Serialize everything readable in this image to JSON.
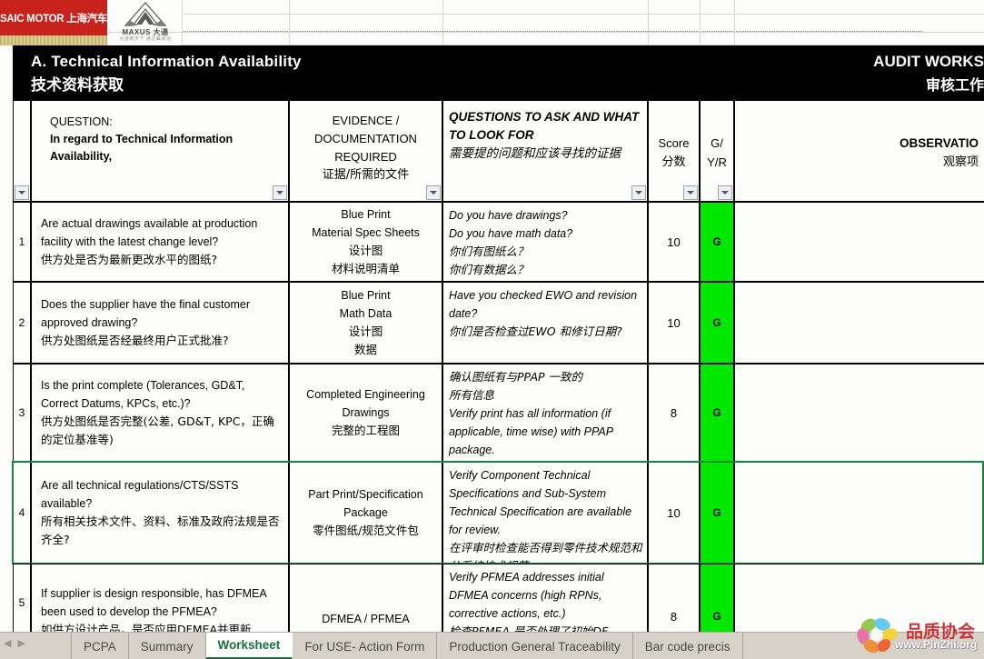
{
  "branding": {
    "saic_logo_text": "SAIC MOTOR 上海汽车",
    "maxus_wordmark": "MAXUS 大通",
    "maxus_tagline": "大道致天下  通达赢成功"
  },
  "banner": {
    "section_en": "A.  Technical Information Availability",
    "section_cn": "技术资料获取",
    "doc_title_en": "AUDIT WORKS",
    "doc_title_cn": "审核工作"
  },
  "columns": {
    "row_number": "",
    "question": {
      "label": "QUESTION:",
      "label_bold": "In regard to Technical Information Availability,"
    },
    "evidence": {
      "en": "EVIDENCE / DOCUMENTATION REQUIRED",
      "cn": "证据/所需的文件"
    },
    "questions_to_ask": {
      "en": "QUESTIONS TO ASK AND WHAT TO LOOK FOR",
      "cn": "需要提的问题和应该寻找的证据"
    },
    "score": {
      "en": "Score",
      "cn": "分数"
    },
    "gyr": {
      "en": "G/",
      "en2": "Y/R"
    },
    "observations": {
      "en": "OBSERVATIO",
      "cn": "观察项"
    }
  },
  "filter_buttons": [
    "filter-question",
    "filter-evidence",
    "filter-questions-to-ask",
    "filter-score",
    "filter-gyr"
  ],
  "rows": [
    {
      "num": "1",
      "question_en": "Are actual drawings available at production facility with the latest change level?",
      "question_cn": "供方处是否为最新更改水平的图纸?",
      "evidence_en": [
        "Blue Print",
        "Material Spec Sheets"
      ],
      "evidence_cn": [
        "设计图",
        "材料说明清单"
      ],
      "ask_en": [
        "Do you have drawings?",
        "Do you have math data?"
      ],
      "ask_cn": [
        "你们有图纸么？",
        "你们有数据么？"
      ],
      "score": "10",
      "gyr": "G",
      "gyr_color": "#00E800",
      "observations": ""
    },
    {
      "num": "2",
      "question_en": "Does the supplier have the final customer approved drawing?",
      "question_cn": "供方处图纸是否经最终用户正式批准?",
      "evidence_en": [
        "Blue Print",
        "Math Data"
      ],
      "evidence_cn": [
        "设计图",
        "数据"
      ],
      "ask_en": [
        "Have you checked EWO and revision date?"
      ],
      "ask_cn": [
        "你们是否检查过EWO 和修订日期?"
      ],
      "score": "10",
      "gyr": "G",
      "gyr_color": "#00E800",
      "observations": ""
    },
    {
      "num": "3",
      "question_en": "Is the print complete (Tolerances, GD&T, Correct Datums, KPCs, etc.)?",
      "question_cn": "供方处图纸是否完整(公差, GD&T, KPC，正确的定位基准等)",
      "evidence_en": [
        "Completed Engineering Drawings"
      ],
      "evidence_cn": [
        "完整的工程图"
      ],
      "ask_cn_first": [
        "确认图纸有与PPAP 一致的",
        "所有信息"
      ],
      "ask_en": [
        "Verify print has all information (if applicable, time wise) with PPAP package."
      ],
      "ask_cn": [],
      "score": "8",
      "gyr": "G",
      "gyr_color": "#00E800",
      "observations": ""
    },
    {
      "num": "4",
      "question_en": "Are all technical regulations/CTS/SSTS available?",
      "question_cn": "所有相关技术文件、资料、标准及政府法规是否齐全?",
      "evidence_en": [
        "Part Print/Specification Package"
      ],
      "evidence_cn": [
        "零件图纸/规范文件包"
      ],
      "ask_en": [
        "Verify Component Technical Specifications and Sub-System Technical Specification are available for review."
      ],
      "ask_cn": [
        "在评审时检查能否得到零件技术规范和分系统技术规范"
      ],
      "score": "10",
      "gyr": "G",
      "gyr_color": "#00E800",
      "observations": "",
      "selected": true
    },
    {
      "num": "5",
      "question_en": "If supplier is design responsible, has DFMEA been used to develop the PFMEA?",
      "question_cn": "如供方设计产品，是否应用DFMEA并更新",
      "evidence_en": [
        "DFMEA / PFMEA"
      ],
      "evidence_cn": [],
      "ask_en": [
        "Verify PFMEA addresses initial DFMEA concerns (high RPNs, corrective actions, etc.)"
      ],
      "ask_cn": [
        "检查PFMEA 是否处理了初始DF"
      ],
      "score": "8",
      "gyr": "G",
      "gyr_color": "#00E800",
      "observations": ""
    }
  ],
  "sheet_tabs": {
    "nav": [
      "◀",
      "▶"
    ],
    "items": [
      {
        "label": "PCPA",
        "active": false
      },
      {
        "label": "Summary",
        "active": false
      },
      {
        "label": "Worksheet",
        "active": true
      },
      {
        "label": "For USE- Action Form",
        "active": false
      },
      {
        "label": "Production General Traceability",
        "active": false
      },
      {
        "label": "Bar code precis",
        "active": false
      }
    ]
  },
  "watermark": {
    "cn": "品质协会",
    "url": "www.PinZhi.org"
  }
}
